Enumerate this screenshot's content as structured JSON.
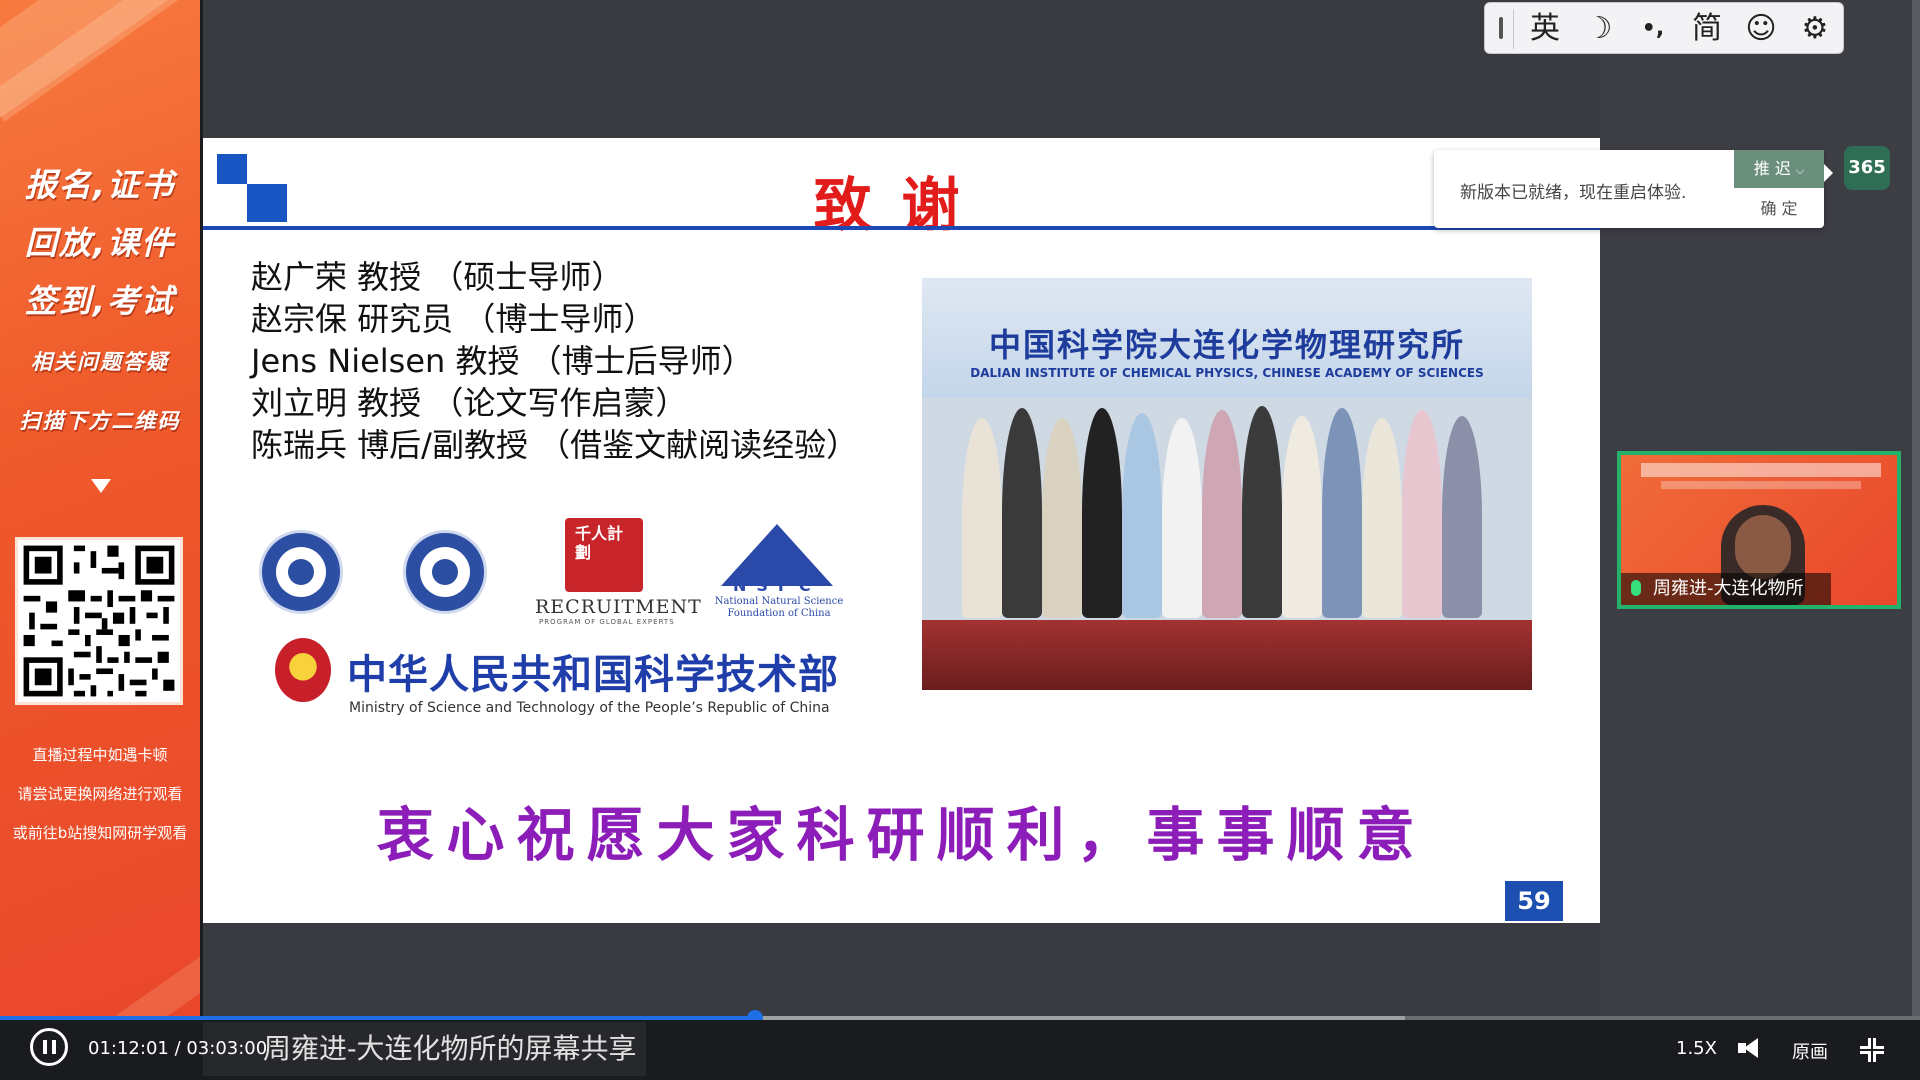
{
  "sidebar": {
    "promo_lines": [
      "报名,证书",
      "回放,课件",
      "签到,考试"
    ],
    "promo_small": [
      "相关问题答疑",
      "扫描下方二维码"
    ],
    "tips": [
      "直播过程中如遇卡顿",
      "请尝试更换网络进行观看",
      "或前往b站搜知网研学观看"
    ]
  },
  "slide": {
    "title": "致谢",
    "acknowledgements": [
      "赵广荣 教授 （硕士导师）",
      "赵宗保 研究员 （博士导师）",
      "Jens Nielsen 教授 （博士后导师）",
      "刘立明 教授 （论文写作启蒙）",
      "陈瑞兵 博后/副教授 （借鉴文献阅读经验）"
    ],
    "photo": {
      "institute_cn": "中国科学院大连化学物理研究所",
      "institute_en": "DALIAN INSTITUTE OF CHEMICAL PHYSICS, CHINESE ACADEMY OF SCIENCES"
    },
    "logos": {
      "recruitment_char": "千人計劃",
      "recruitment": "RECRUITMENT",
      "recruitment_sub": "PROGRAM OF GLOBAL EXPERTS",
      "nsfc": "NSFC",
      "nsfc_sub": "National Natural Science Foundation of China",
      "most_cn": "中华人民共和国科学技术部",
      "most_en": "Ministry of Science and Technology of the People’s Republic of China"
    },
    "closing": "衷心祝愿大家科研顺利，事事顺意",
    "page_number": "59"
  },
  "ime": {
    "lang": "英",
    "moon_icon": "☽",
    "punct": "•,",
    "script": "简",
    "emoji_icon": "☺",
    "settings_icon": "⚙"
  },
  "notice": {
    "message": "新版本已就绪，现在重启体验.",
    "later": "推 迟",
    "confirm": "确 定"
  },
  "badge": "365",
  "speaker": {
    "name": "周雍进-大连化物所"
  },
  "player": {
    "time": "01:12:01 / 03:03:00",
    "progress": 0.393,
    "buffered": 0.732,
    "share_label": "周雍进-大连化物所的屏幕共享",
    "speed": "1.5X",
    "quality": "原画"
  }
}
